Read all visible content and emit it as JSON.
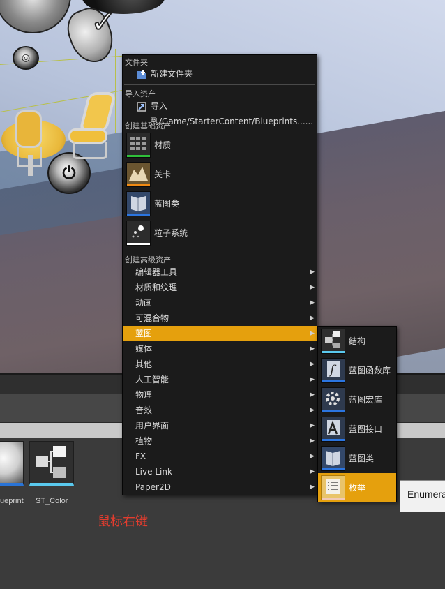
{
  "menu": {
    "sections": {
      "folder": "文件夹",
      "import": "导入资产",
      "basic": "创建基础资产",
      "advanced": "创建高级资产"
    },
    "new_folder": "新建文件夹",
    "import_to": "导入到/Game/StarterContent/Blueprints......",
    "basic_assets": [
      {
        "label": "材质",
        "icon": "material-icon",
        "color": "#2fbf3a"
      },
      {
        "label": "关卡",
        "icon": "level-icon",
        "color": "#f08a13"
      },
      {
        "label": "蓝图类",
        "icon": "blueprint-class-icon",
        "color": "#2b75e0"
      },
      {
        "label": "粒子系统",
        "icon": "particle-system-icon",
        "color": "#ffffff"
      }
    ],
    "advanced_items": [
      {
        "label": "编辑器工具",
        "active": false
      },
      {
        "label": "材质和纹理",
        "active": false
      },
      {
        "label": "动画",
        "active": false
      },
      {
        "label": "可混合物",
        "active": false
      },
      {
        "label": "蓝图",
        "active": true
      },
      {
        "label": "媒体",
        "active": false
      },
      {
        "label": "其他",
        "active": false
      },
      {
        "label": "人工智能",
        "active": false
      },
      {
        "label": "物理",
        "active": false
      },
      {
        "label": "音效",
        "active": false
      },
      {
        "label": "用户界面",
        "active": false
      },
      {
        "label": "植物",
        "active": false
      },
      {
        "label": "FX",
        "active": false
      },
      {
        "label": "Live Link",
        "active": false
      },
      {
        "label": "Paper2D",
        "active": false
      }
    ]
  },
  "submenu": {
    "items": [
      {
        "label": "结构",
        "icon": "struct-icon",
        "color": "#5ac9ee",
        "active": false
      },
      {
        "label": "蓝图函数库",
        "icon": "function-library-icon",
        "color": "#2b75e0",
        "active": false
      },
      {
        "label": "蓝图宏库",
        "icon": "macro-library-icon",
        "color": "#2b75e0",
        "active": false
      },
      {
        "label": "蓝图接口",
        "icon": "interface-icon",
        "color": "#2b75e0",
        "active": false
      },
      {
        "label": "蓝图类",
        "icon": "blueprint-class-icon",
        "color": "#2b75e0",
        "active": false
      },
      {
        "label": "枚举",
        "icon": "enum-icon",
        "color": "#f2c9b5",
        "active": true
      }
    ]
  },
  "tooltip": "Enumera",
  "assets": [
    {
      "label": "ueprint",
      "icon": "sphere-thumbnail-icon"
    },
    {
      "label": "ST_Color",
      "icon": "struct-thumbnail-icon"
    }
  ],
  "hint": "鼠标右键"
}
